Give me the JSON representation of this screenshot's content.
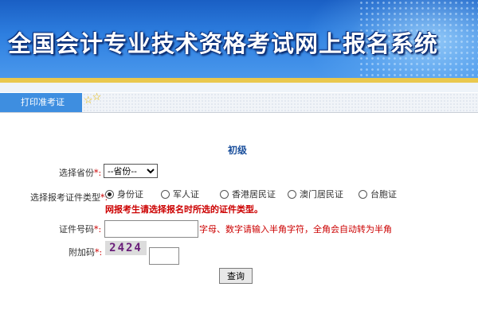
{
  "header": {
    "title": "全国会计专业技术资格考试网上报名系统"
  },
  "tabs": [
    {
      "label": "打印准考证"
    }
  ],
  "form": {
    "level_title": "初级",
    "province": {
      "label": "选择省份",
      "required_mark": "*:",
      "selected": "--省份--"
    },
    "id_type": {
      "label": "选择报考证件类型",
      "required_mark": "*:",
      "options": [
        "身份证",
        "军人证",
        "香港居民证",
        "澳门居民证",
        "台胞证"
      ],
      "selected_index": 0,
      "notice": "网报考生请选择报名时所选的证件类型。"
    },
    "id_number": {
      "label": "证件号码",
      "required_mark": "*:",
      "value": "",
      "hint": "字母、数字请输入半角字符，全角会自动转为半角"
    },
    "captcha": {
      "label": "附加码",
      "required_mark": "*:",
      "code": "2424",
      "value": ""
    },
    "submit_label": "查询"
  },
  "colors": {
    "banner_blue": "#2e7fe0",
    "tab_blue": "#3e8ee0",
    "required_red": "#cc0000",
    "gold_line": "#e9c84e"
  },
  "icons": {
    "tab_stars": "star-icon"
  }
}
